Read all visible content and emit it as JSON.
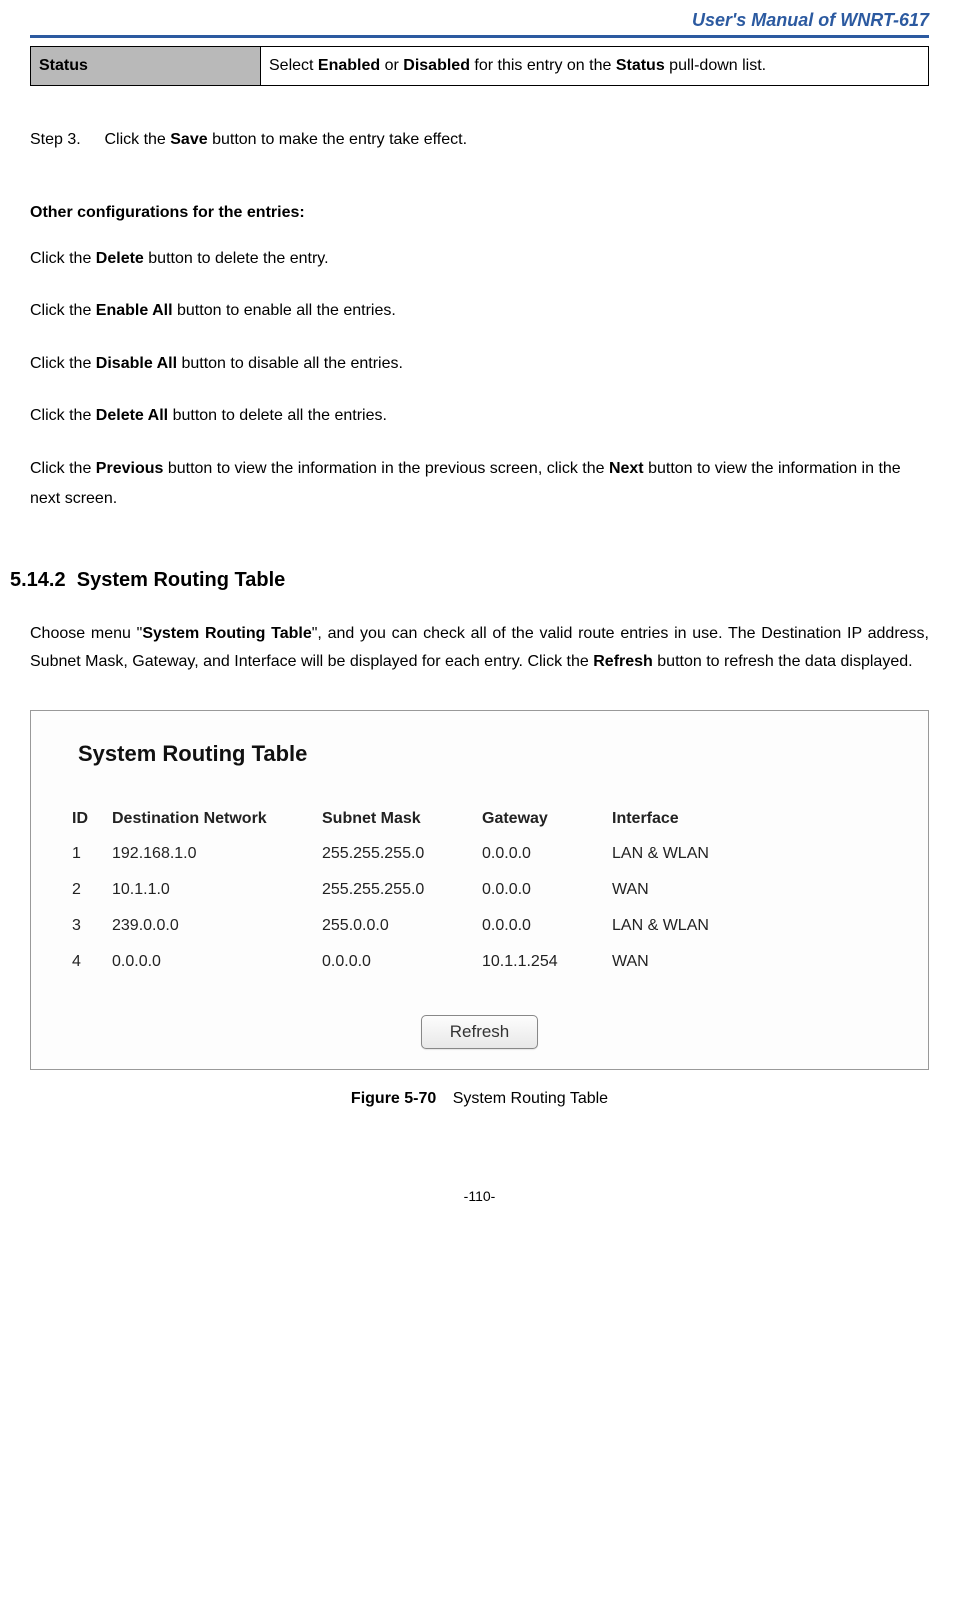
{
  "header": {
    "title": "User's  Manual  of  WNRT-617"
  },
  "status_table": {
    "label": "Status",
    "desc_pre": "Select ",
    "desc_b1": "Enabled",
    "desc_mid1": " or ",
    "desc_b2": "Disabled",
    "desc_mid2": " for this entry on the ",
    "desc_b3": "Status",
    "desc_post": " pull-down list."
  },
  "step3": {
    "label": "Step 3.",
    "pre": "Click the ",
    "b": "Save",
    "post": " button to make the entry take effect."
  },
  "other": {
    "heading": "Other configurations for the entries:",
    "delete": {
      "pre": "Click the ",
      "b": "Delete",
      "post": " button to delete the entry."
    },
    "enable_all": {
      "pre": "Click the ",
      "b": "Enable All",
      "post": " button to enable all the entries."
    },
    "disable_all": {
      "pre": "Click the ",
      "b": "Disable All",
      "post": " button to disable all the entries."
    },
    "delete_all": {
      "pre": "Click the ",
      "b": "Delete All",
      "post": " button to delete all the entries."
    },
    "prev_next": {
      "pre": "Click the ",
      "b1": "Previous",
      "mid": " button to view the information in the previous screen, click the ",
      "b2": "Next",
      "post": " button to view the information in the next screen."
    }
  },
  "section": {
    "number": "5.14.2",
    "title": "System Routing Table",
    "para": {
      "pre": "Choose menu \"",
      "b1": "System Routing Table",
      "mid": "\", and you can check all of the valid route entries in use. The Destination IP address, Subnet Mask, Gateway, and Interface will be displayed for each entry. Click the ",
      "b2": "Refresh",
      "post": " button to refresh the data displayed."
    }
  },
  "routing": {
    "panel_title": "System Routing Table",
    "headers": {
      "id": "ID",
      "dest": "Destination Network",
      "mask": "Subnet Mask",
      "gateway": "Gateway",
      "interface": "Interface"
    },
    "rows": [
      {
        "id": "1",
        "dest": "192.168.1.0",
        "mask": "255.255.255.0",
        "gateway": "0.0.0.0",
        "interface": "LAN & WLAN"
      },
      {
        "id": "2",
        "dest": "10.1.1.0",
        "mask": "255.255.255.0",
        "gateway": "0.0.0.0",
        "interface": "WAN"
      },
      {
        "id": "3",
        "dest": "239.0.0.0",
        "mask": "255.0.0.0",
        "gateway": "0.0.0.0",
        "interface": "LAN & WLAN"
      },
      {
        "id": "4",
        "dest": "0.0.0.0",
        "mask": "0.0.0.0",
        "gateway": "10.1.1.254",
        "interface": "WAN"
      }
    ],
    "refresh_label": "Refresh"
  },
  "figure": {
    "label": "Figure 5-70",
    "caption": "System Routing Table"
  },
  "page_number": "-110-"
}
